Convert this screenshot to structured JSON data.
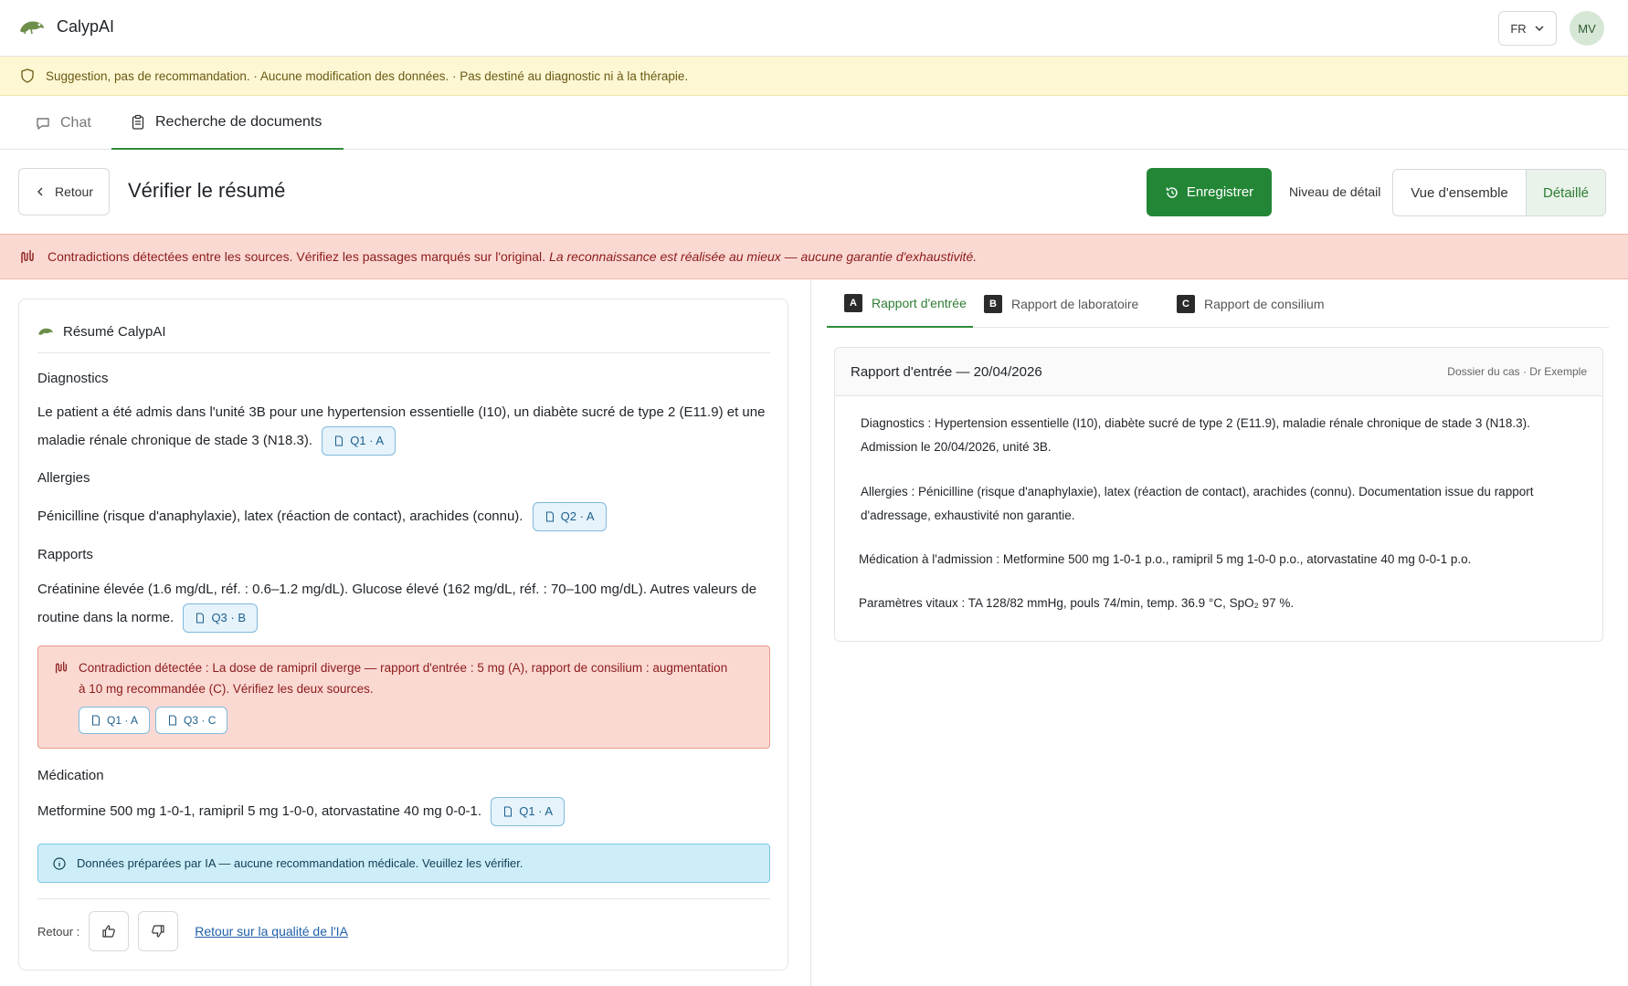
{
  "app": {
    "name": "CalypAI",
    "language": "FR",
    "user_initials": "MV"
  },
  "disclaimer": "Suggestion, pas de recommandation. · Aucune modification des données. · Pas destiné au diagnostic ni à la thérapie.",
  "tabs": {
    "chat": "Chat",
    "documents": "Recherche de documents"
  },
  "header": {
    "back": "Retour",
    "title": "Vérifier le résumé",
    "save": "Enregistrer",
    "detail_label": "Niveau de détail",
    "overview": "Vue d'ensemble",
    "detailed": "Détaillé"
  },
  "contradiction_banner": {
    "text": "Contradictions détectées entre les sources. Vérifiez les passages marqués sur l'original.",
    "note": "La reconnaissance est réalisée au mieux — aucune garantie d'exhaustivité."
  },
  "summary": {
    "title": "Résumé CalypAI",
    "diagnostics": {
      "title": "Diagnostics",
      "text": "Le patient a été admis dans l'unité 3B pour une hypertension essentielle (I10), un diabète sucré de type 2 (E11.9) et une maladie rénale chronique de stade 3 (N18.3).",
      "chip": "Q1 · A"
    },
    "allergies": {
      "title": "Allergies",
      "text": "Pénicilline (risque d'anaphylaxie), latex (réaction de contact), arachides (connu).",
      "chip": "Q2 · A"
    },
    "reports": {
      "title": "Rapports",
      "text": "Créatinine élevée (1.6 mg/dL, réf. : 0.6–1.2 mg/dL). Glucose élevé (162 mg/dL, réf. : 70–100 mg/dL). Autres valeurs de routine dans la norme.",
      "chip": "Q3 · B"
    },
    "contradiction": {
      "text": "Contradiction détectée : La dose de ramipril diverge — rapport d'entrée : 5 mg (A), rapport de consilium : augmentation à 10 mg recommandée (C). Vérifiez les deux sources.",
      "chip1": "Q1 · A",
      "chip2": "Q3 · C"
    },
    "medication": {
      "title": "Médication",
      "text": "Metformine 500 mg 1-0-1, ramipril 5 mg 1-0-0, atorvastatine 40 mg 0-0-1.",
      "chip": "Q1 · A"
    },
    "info": "Données préparées par IA — aucune recommandation médicale. Veuillez les vérifier.",
    "feedback": {
      "label": "Retour :",
      "link": "Retour sur la qualité de l'IA"
    }
  },
  "documents": {
    "tabs": [
      {
        "letter": "A",
        "label": "Rapport d'entrée"
      },
      {
        "letter": "B",
        "label": "Rapport de laboratoire"
      },
      {
        "letter": "C",
        "label": "Rapport de consilium"
      }
    ],
    "card": {
      "title": "Rapport d'entrée — 20/04/2026",
      "meta": "Dossier du cas · Dr Exemple",
      "paragraphs": [
        "Diagnostics : Hypertension essentielle (I10), diabète sucré de type 2 (E11.9), maladie rénale chronique de stade 3 (N18.3). Admission le 20/04/2026, unité 3B.",
        "Allergies : Pénicilline (risque d'anaphylaxie), latex (réaction de contact), arachides (connu). Documentation issue du rapport d'adressage, exhaustivité non garantie.",
        "Médication à l'admission : Metformine 500 mg 1-0-1 p.o., ramipril 5 mg 1-0-0 p.o., atorvastatine 40 mg 0-0-1 p.o.",
        "Paramètres vitaux : TA 128/82 mmHg, pouls 74/min, temp. 36.9 °C, SpO₂ 97 %."
      ]
    }
  },
  "colors": {
    "accent": "#238636",
    "warning_bg": "#fdf7d3",
    "danger_bg": "#fbd9d3",
    "info_bg": "#cdeef9"
  }
}
